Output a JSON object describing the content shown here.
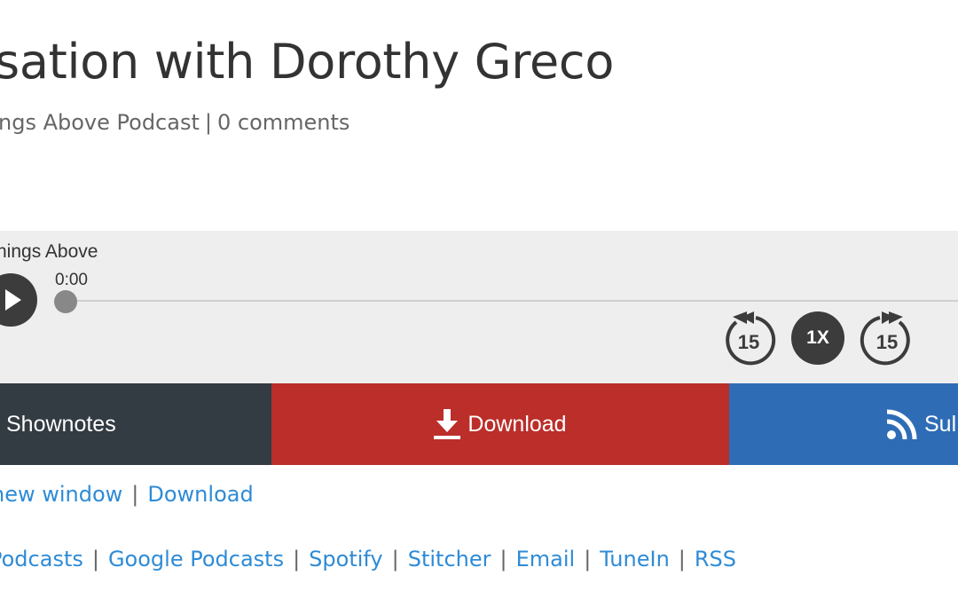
{
  "post": {
    "title": "sation with Dorothy Greco",
    "meta_category": "ngs Above Podcast",
    "meta_separator": "|",
    "meta_comments": "0 comments"
  },
  "player": {
    "podcast_name": "hings Above",
    "current_time": "0:00",
    "progress": 0,
    "skip_back_label": "15",
    "skip_forward_label": "15",
    "speed_label": "1X"
  },
  "action_bar": {
    "shownotes_label": "Shownotes",
    "download_label": "Download",
    "subscribe_label": "Sul",
    "colors": {
      "shownotes": "#333b43",
      "download": "#bb2e2a",
      "subscribe": "#2e6db6"
    }
  },
  "links_row1": {
    "new_window": "new window",
    "separator": "|",
    "download": "Download"
  },
  "subscribe_links": {
    "separator": "|",
    "items": [
      "Podcasts",
      "Google Podcasts",
      "Spotify",
      "Stitcher",
      "Email",
      "TuneIn",
      "RSS"
    ]
  },
  "icons": {
    "play": "play-icon",
    "skip_back": "skip-back-15-icon",
    "skip_forward": "skip-forward-15-icon",
    "download": "download-arrow-icon",
    "subscribe": "rss-icon"
  },
  "colors": {
    "link": "#2e8bd6",
    "text": "#333333",
    "muted": "#666666",
    "player_bg": "#eeeeee"
  }
}
